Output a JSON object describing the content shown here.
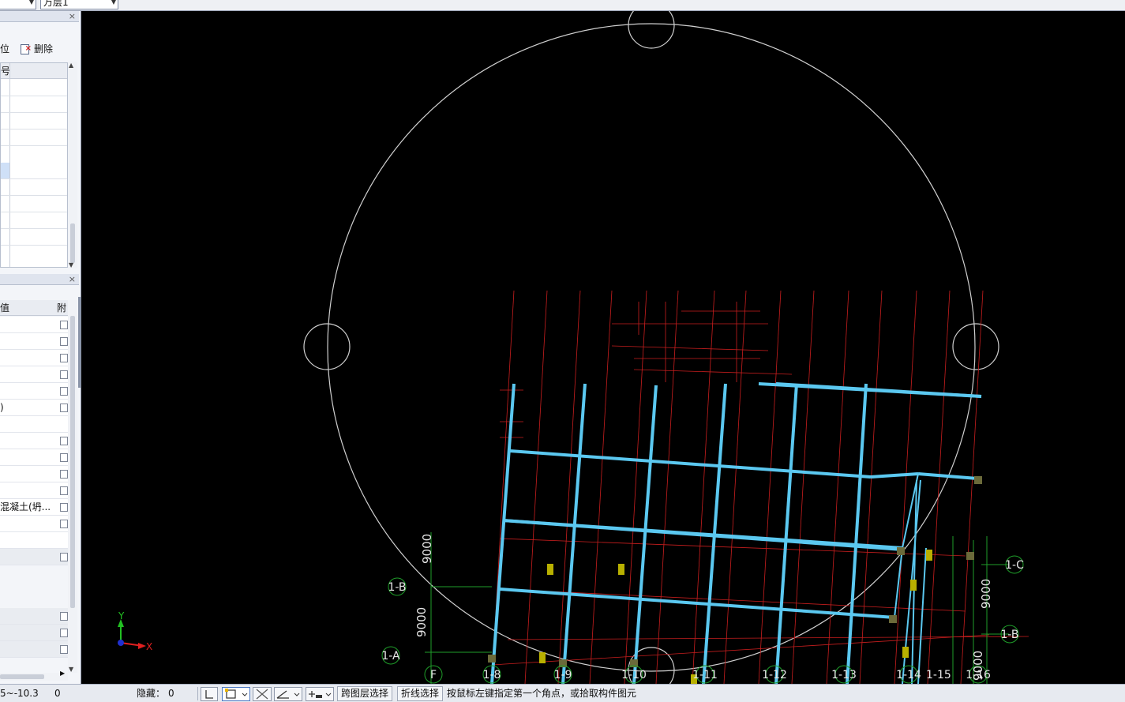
{
  "topbar": {
    "layer_combo_value": "万层1"
  },
  "left_panel": {
    "component_list": {
      "close_glyph": "×",
      "toolbar_fragment": "位",
      "delete_label": "删除",
      "column_header": "号"
    },
    "properties": {
      "close_glyph": "×",
      "col_value": "值",
      "col_attached": "附",
      "rows": [
        {
          "value": "",
          "checkbox": true
        },
        {
          "value": "",
          "checkbox": true
        },
        {
          "value": "",
          "checkbox": true
        },
        {
          "value": "",
          "checkbox": true
        },
        {
          "value": "",
          "checkbox": true
        },
        {
          "value": ")",
          "checkbox": true
        },
        {
          "value": "",
          "checkbox": false
        },
        {
          "value": "",
          "checkbox": true
        },
        {
          "value": "",
          "checkbox": true
        },
        {
          "value": "",
          "checkbox": true
        },
        {
          "value": "",
          "checkbox": true
        },
        {
          "value": "混凝土(坍...",
          "checkbox": true
        },
        {
          "value": "",
          "checkbox": true
        },
        {
          "value": "",
          "checkbox": false
        },
        {
          "value": "",
          "checkbox": true,
          "gray": true
        },
        {
          "value": "",
          "checkbox": true,
          "gray": true
        },
        {
          "value": "",
          "checkbox": true,
          "gray": true
        },
        {
          "value": "",
          "checkbox": true,
          "gray": true
        }
      ]
    }
  },
  "canvas": {
    "axis_labels": [
      "1-B",
      "1-A",
      "F",
      "1-8",
      "1-9",
      "1-10",
      "1-11",
      "1-12",
      "1-13",
      "1-14",
      "1-15",
      "1-16",
      "1-C",
      "1-B"
    ],
    "dimensions": [
      "9000",
      "9000",
      "9000",
      "9000"
    ],
    "ucs": {
      "y": "Y",
      "x": "X"
    },
    "colors": {
      "background": "#000000",
      "beam": "#5bc8f0",
      "axis_red": "#c81e1e",
      "grid_green": "#1f9e2a",
      "circle": "#d0d0d0",
      "column": "#6b6a3a"
    }
  },
  "statusbar": {
    "coords": "5~-10.3",
    "floor_value": "0",
    "hidden_label": "隐藏：",
    "hidden_value": "0",
    "cross_layer_select": "跨图层选择",
    "polyline_select": "折线选择",
    "prompt": "按鼠标左键指定第一个角点，或拾取构件图元"
  }
}
